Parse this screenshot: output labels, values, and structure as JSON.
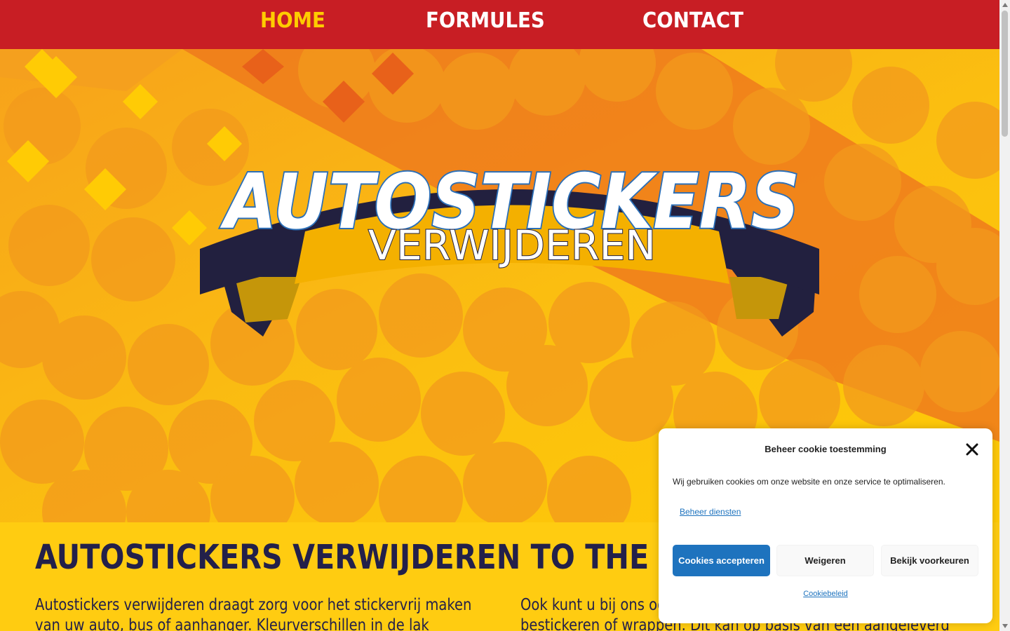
{
  "nav": {
    "items": [
      {
        "label": "HOME",
        "active": true
      },
      {
        "label": "FORMULES",
        "active": false
      },
      {
        "label": "CONTACT",
        "active": false
      }
    ]
  },
  "hero": {
    "logo_top": "AUTOSTICKERS",
    "logo_bottom": "VERWIJDEREN"
  },
  "main": {
    "headline": "AUTOSTICKERS VERWIJDEREN TO THE RESCUE!",
    "col1": "Autostickers verwijderen draagt zorg voor het stickervrij maken van uw auto, bus of aanhanger. Kleurverschillen in de lak herstellen",
    "col2": "Ook kunt u bij ons ook terecht om uw voertuig opnieuw te bestickeren of wrappen. Dit kan op basis van een aangeleverd"
  },
  "cookie": {
    "title": "Beheer cookie toestemming",
    "text": "Wij gebruiken cookies om onze website en onze service te optimaliseren.",
    "manage": "Beheer diensten",
    "accept": "Cookies accepteren",
    "deny": "Weigeren",
    "preferences": "Bekijk voorkeuren",
    "policy": "Cookiebeleid"
  },
  "colors": {
    "nav_bg": "#c81e24",
    "active": "#ffcc00",
    "navy": "#23204a",
    "accent_blue": "#1e73be"
  }
}
